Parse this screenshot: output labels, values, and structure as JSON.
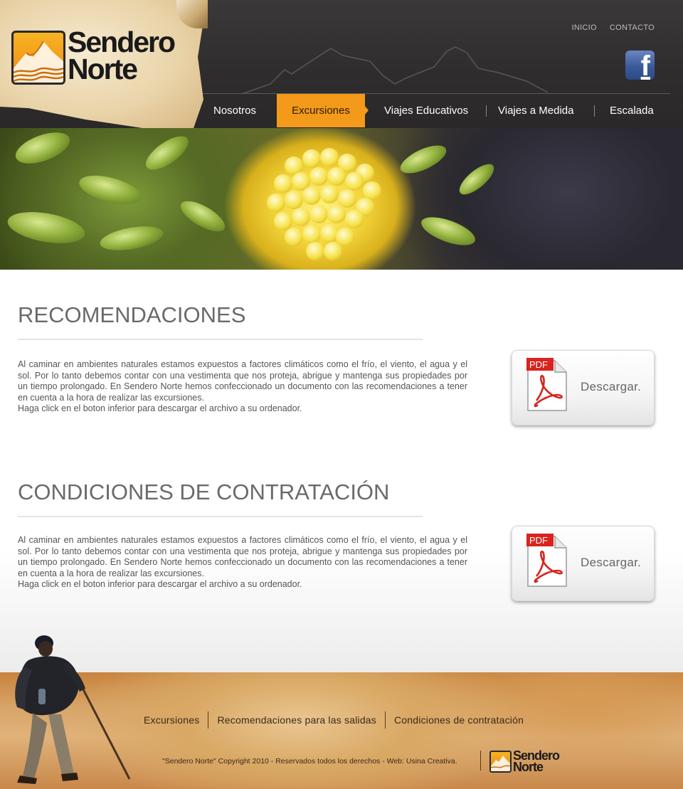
{
  "brand": {
    "logo_line1": "Sendero",
    "logo_line2": "Norte"
  },
  "top_links": {
    "inicio": "INICIO",
    "contacto": "CONTACTO"
  },
  "social": {
    "icon": "facebook-icon",
    "glyph": "f"
  },
  "nav": {
    "items": [
      "Nosotros",
      "Excursiones",
      "Viajes Educativos",
      "Viajes a Medida",
      "Escalada"
    ],
    "active": "Excursiones",
    "active_color": "#f39a1a"
  },
  "sections": [
    {
      "title": "RECOMENDACIONES",
      "text": "Al caminar en ambientes naturales estamos expuestos a factores climáticos como el frío, el viento, el agua y el sol. Por lo tanto debemos contar con una vestimenta que nos proteja, abrigue y mantenga sus propiedades por un tiempo prolongado. En Sendero Norte hemos confeccionado un documento con las recomendaciones a tener en cuenta a la hora de realizar las excursiones.",
      "text_last": "Haga click en el boton inferior para descargar el archivo a su ordenador.",
      "button_label": "Descargar.",
      "pdf_badge": "PDF"
    },
    {
      "title": "CONDICIONES DE CONTRATACIÓN",
      "text": "Al caminar en ambientes naturales estamos expuestos a factores climáticos como el frío, el viento, el agua y el sol. Por lo tanto debemos contar con una vestimenta que nos proteja, abrigue y mantenga sus propiedades por un tiempo prolongado. En Sendero Norte hemos confeccionado un documento con las recomendaciones a tener en cuenta a la hora de realizar las excursiones.",
      "text_last": "Haga click en el boton inferior para descargar el archivo a su ordenador.",
      "button_label": "Descargar.",
      "pdf_badge": "PDF"
    }
  ],
  "footer": {
    "links": [
      "Excursiones",
      "Recomendaciones para las salidas",
      "Condiciones de contratación"
    ],
    "copyright": "\"Sendero Norte\" Copyright 2010 - Reservados todos los derechos - Web: Usina Creativa.",
    "logo_line1": "Sendero",
    "logo_line2": "Norte"
  },
  "colors": {
    "accent": "#f39a1a",
    "header_bg": "#2e2c2c",
    "pdf_red": "#d8231f"
  }
}
